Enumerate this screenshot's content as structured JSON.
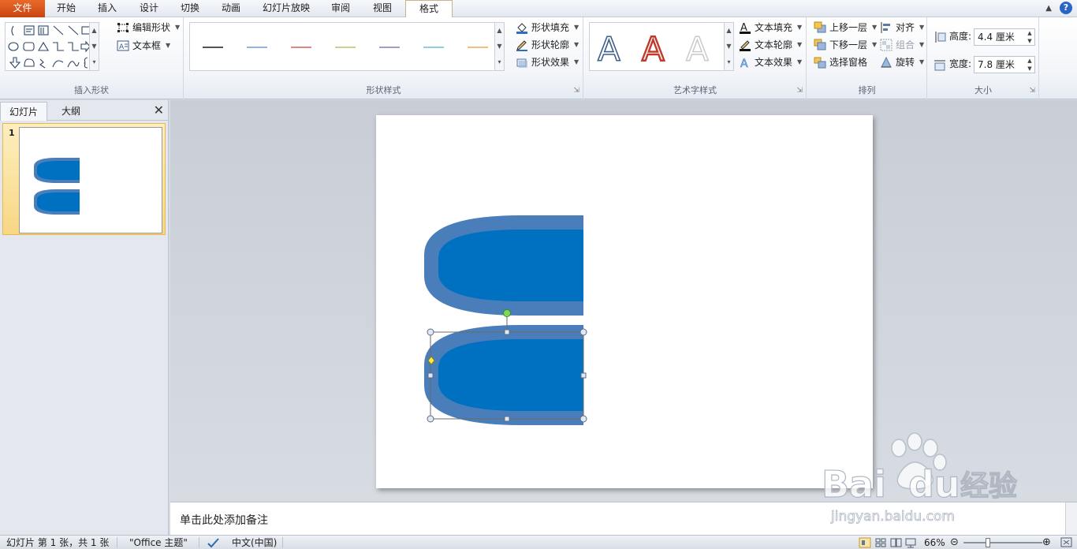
{
  "tabs": [
    {
      "label": "文件"
    },
    {
      "label": "开始"
    },
    {
      "label": "插入"
    },
    {
      "label": "设计"
    },
    {
      "label": "切换"
    },
    {
      "label": "动画"
    },
    {
      "label": "幻灯片放映"
    },
    {
      "label": "审阅"
    },
    {
      "label": "视图"
    },
    {
      "label": "格式"
    }
  ],
  "ribbon": {
    "insert_shapes": {
      "label": "插入形状",
      "edit_shape": "编辑形状",
      "textbox": "文本框"
    },
    "shape_styles": {
      "label": "形状样式",
      "fill": "形状填充",
      "outline": "形状轮廓",
      "effects": "形状效果",
      "line_colors": [
        "#555555",
        "#8fb4e3",
        "#e48585",
        "#c8d38f",
        "#a89ac8",
        "#8fd0dc",
        "#f5bd80"
      ]
    },
    "wordart": {
      "label": "艺术字样式",
      "text_fill": "文本填充",
      "text_outline": "文本轮廓",
      "text_effects": "文本效果",
      "glyph": "A"
    },
    "arrange": {
      "label": "排列",
      "bring_forward": "上移一层",
      "send_backward": "下移一层",
      "selection_pane": "选择窗格",
      "align": "对齐",
      "group": "组合",
      "rotate": "旋转"
    },
    "size": {
      "label": "大小",
      "height_label": "高度:",
      "height_value": "4.4 厘米",
      "width_label": "宽度:",
      "width_value": "7.8 厘米"
    }
  },
  "left_panel": {
    "tab_slides": "幻灯片",
    "tab_outline": "大纲",
    "slide_number": "1"
  },
  "notes": {
    "placeholder": "单击此处添加备注"
  },
  "status": {
    "slide_info": "幻灯片 第 1 张，共 1 张",
    "theme": "\"Office 主题\"",
    "language": "中文(中国)",
    "zoom": "66%"
  },
  "colors": {
    "shape_fill": "#0070c0",
    "shape_outline": "#4a7ebb",
    "file_tab": "#d9541a"
  },
  "watermark": {
    "brand": "Bai",
    "brand2": "du",
    "cn": "经验",
    "url": "jingyan.baidu.com"
  }
}
